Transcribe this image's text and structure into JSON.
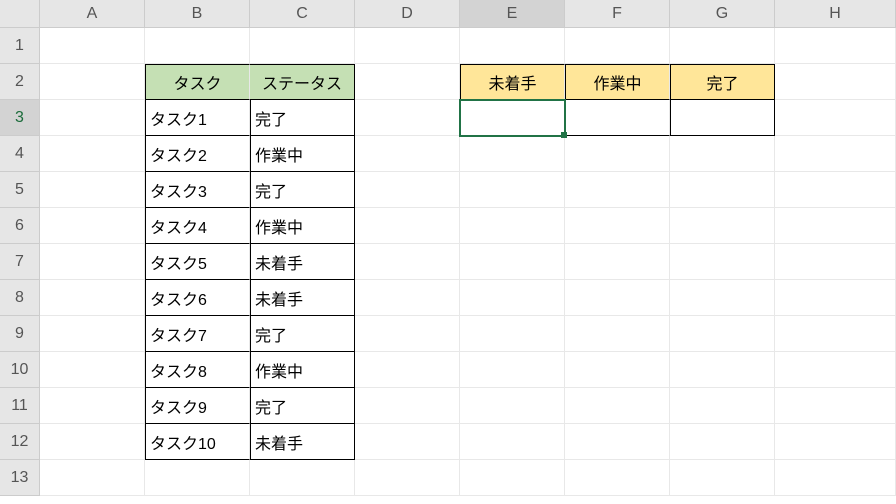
{
  "columns": [
    "A",
    "B",
    "C",
    "D",
    "E",
    "F",
    "G",
    "H"
  ],
  "rows": [
    "1",
    "2",
    "3",
    "4",
    "5",
    "6",
    "7",
    "8",
    "9",
    "10",
    "11",
    "12",
    "13"
  ],
  "selected": {
    "col": "E",
    "row": "3"
  },
  "task_header": {
    "B": "タスク",
    "C": "ステータス"
  },
  "tasks": [
    {
      "name": "タスク1",
      "status": "完了"
    },
    {
      "name": "タスク2",
      "status": "作業中"
    },
    {
      "name": "タスク3",
      "status": "完了"
    },
    {
      "name": "タスク4",
      "status": "作業中"
    },
    {
      "name": "タスク5",
      "status": "未着手"
    },
    {
      "name": "タスク6",
      "status": "未着手"
    },
    {
      "name": "タスク7",
      "status": "完了"
    },
    {
      "name": "タスク8",
      "status": "作業中"
    },
    {
      "name": "タスク9",
      "status": "完了"
    },
    {
      "name": "タスク10",
      "status": "未着手"
    }
  ],
  "status_header": {
    "E": "未着手",
    "F": "作業中",
    "G": "完了"
  },
  "colors": {
    "green": "#c5e0b4",
    "yellow": "#ffe699",
    "select": "#217346"
  }
}
